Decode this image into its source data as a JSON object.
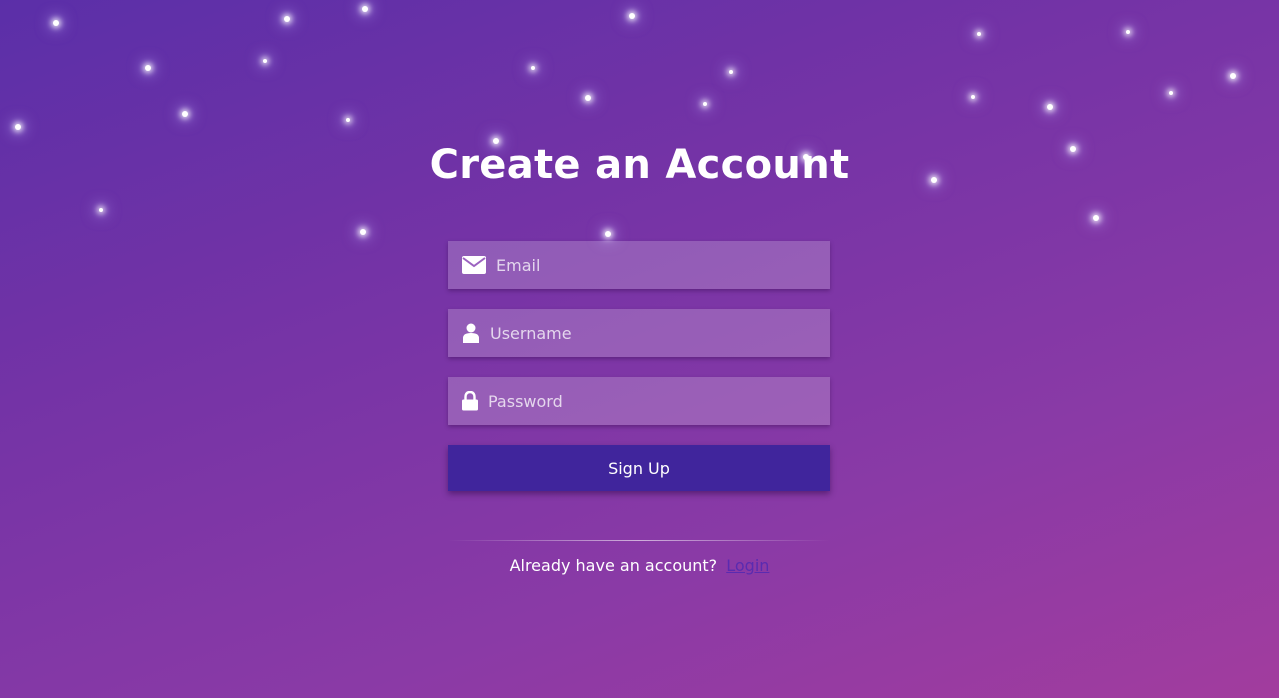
{
  "page": {
    "title": "Create an Account"
  },
  "form": {
    "email": {
      "placeholder": "Email",
      "icon": "envelope-icon"
    },
    "username": {
      "placeholder": "Username",
      "icon": "user-icon"
    },
    "password": {
      "placeholder": "Password",
      "icon": "lock-icon"
    },
    "submit_label": "Sign Up"
  },
  "footer": {
    "prompt": "Already have an account?",
    "login_label": "Login"
  },
  "colors": {
    "background_start": "#5b2fa8",
    "background_end": "#a23c9e",
    "button": "#40259c",
    "login_link": "#5a2bb0"
  }
}
